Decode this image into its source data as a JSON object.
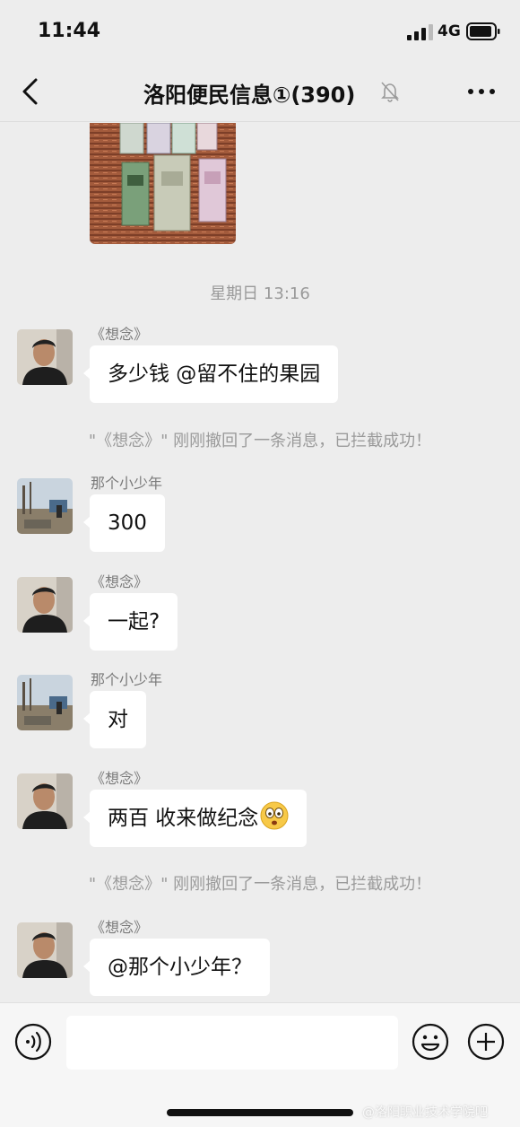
{
  "status_bar": {
    "time": "11:44",
    "network": "4G"
  },
  "nav": {
    "title": "洛阳便民信息①(390)"
  },
  "chat": {
    "time_separator": "星期日 13:16",
    "recall_notice": "\"《想念》\" 刚刚撤回了一条消息，已拦截成功！",
    "messages": [
      {
        "sender": "《想念》",
        "text": "多少钱 @留不住的果园"
      },
      {
        "sender": "那个小少年",
        "text": "300"
      },
      {
        "sender": "《想念》",
        "text": "一起?"
      },
      {
        "sender": "那个小少年",
        "text": "对"
      },
      {
        "sender": "《想念》",
        "text": "两百 收来做纪念"
      },
      {
        "sender": "《想念》",
        "text": "@那个小少年？"
      }
    ]
  },
  "input_bar": {
    "watermark": "@洛阳职业技术学院吧"
  }
}
